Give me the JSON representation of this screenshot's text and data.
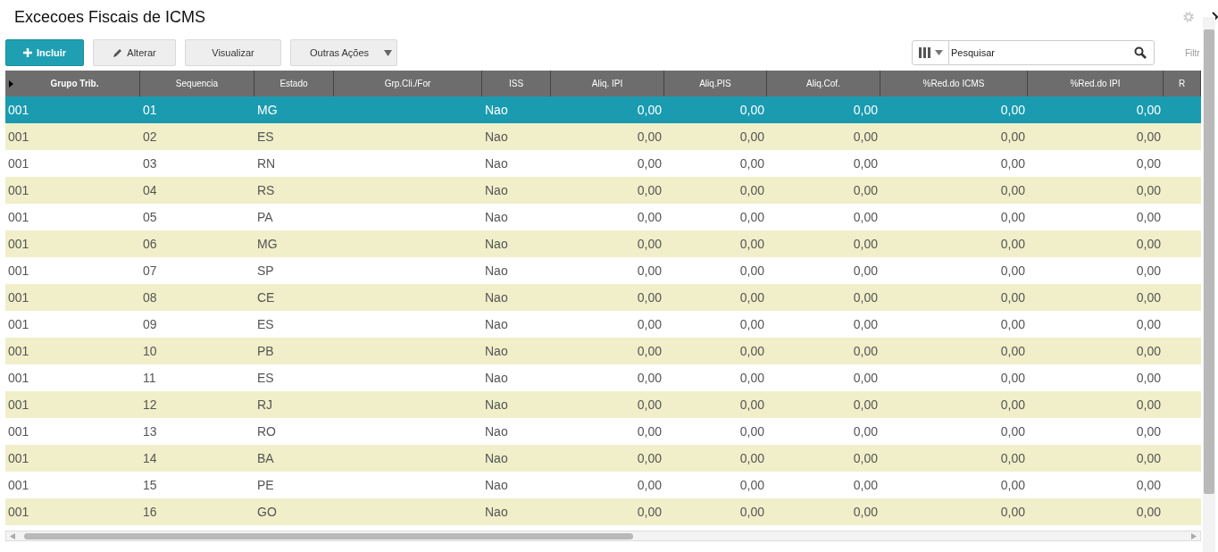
{
  "window": {
    "title": "Excecoes Fiscais de ICMS"
  },
  "toolbar": {
    "buttons": [
      {
        "label": "Incluir",
        "kind": "primary"
      },
      {
        "label": "Alterar",
        "kind": "edit"
      },
      {
        "label": "Visualizar",
        "kind": "plain"
      },
      {
        "label": "Outras Ações",
        "kind": "menu"
      }
    ],
    "search": {
      "placeholder": "Pesquisar"
    },
    "filter_label": "Filtr"
  },
  "table": {
    "columns": [
      "Grupo Trib.",
      "Sequencia",
      "Estado",
      "Grp.Cli./For",
      "ISS",
      "Aliq. IPI",
      "Aliq.PIS",
      "Aliq.Cof.",
      "%Red.do ICMS",
      "%Red.do IPI",
      "R"
    ],
    "rows": [
      {
        "selected": true,
        "cells": [
          "001",
          "01",
          "MG",
          "",
          "Nao",
          "0,00",
          "0,00",
          "0,00",
          "0,00",
          "0,00",
          ""
        ]
      },
      {
        "selected": false,
        "cells": [
          "001",
          "02",
          "ES",
          "",
          "Nao",
          "0,00",
          "0,00",
          "0,00",
          "0,00",
          "0,00",
          ""
        ]
      },
      {
        "selected": false,
        "cells": [
          "001",
          "03",
          "RN",
          "",
          "Nao",
          "0,00",
          "0,00",
          "0,00",
          "0,00",
          "0,00",
          ""
        ]
      },
      {
        "selected": false,
        "cells": [
          "001",
          "04",
          "RS",
          "",
          "Nao",
          "0,00",
          "0,00",
          "0,00",
          "0,00",
          "0,00",
          ""
        ]
      },
      {
        "selected": false,
        "cells": [
          "001",
          "05",
          "PA",
          "",
          "Nao",
          "0,00",
          "0,00",
          "0,00",
          "0,00",
          "0,00",
          ""
        ]
      },
      {
        "selected": false,
        "cells": [
          "001",
          "06",
          "MG",
          "",
          "Nao",
          "0,00",
          "0,00",
          "0,00",
          "0,00",
          "0,00",
          ""
        ]
      },
      {
        "selected": false,
        "cells": [
          "001",
          "07",
          "SP",
          "",
          "Nao",
          "0,00",
          "0,00",
          "0,00",
          "0,00",
          "0,00",
          ""
        ]
      },
      {
        "selected": false,
        "cells": [
          "001",
          "08",
          "CE",
          "",
          "Nao",
          "0,00",
          "0,00",
          "0,00",
          "0,00",
          "0,00",
          ""
        ]
      },
      {
        "selected": false,
        "cells": [
          "001",
          "09",
          "ES",
          "",
          "Nao",
          "0,00",
          "0,00",
          "0,00",
          "0,00",
          "0,00",
          ""
        ]
      },
      {
        "selected": false,
        "cells": [
          "001",
          "10",
          "PB",
          "",
          "Nao",
          "0,00",
          "0,00",
          "0,00",
          "0,00",
          "0,00",
          ""
        ]
      },
      {
        "selected": false,
        "cells": [
          "001",
          "11",
          "ES",
          "",
          "Nao",
          "0,00",
          "0,00",
          "0,00",
          "0,00",
          "0,00",
          ""
        ]
      },
      {
        "selected": false,
        "cells": [
          "001",
          "12",
          "RJ",
          "",
          "Nao",
          "0,00",
          "0,00",
          "0,00",
          "0,00",
          "0,00",
          ""
        ]
      },
      {
        "selected": false,
        "cells": [
          "001",
          "13",
          "RO",
          "",
          "Nao",
          "0,00",
          "0,00",
          "0,00",
          "0,00",
          "0,00",
          ""
        ]
      },
      {
        "selected": false,
        "cells": [
          "001",
          "14",
          "BA",
          "",
          "Nao",
          "0,00",
          "0,00",
          "0,00",
          "0,00",
          "0,00",
          ""
        ]
      },
      {
        "selected": false,
        "cells": [
          "001",
          "15",
          "PE",
          "",
          "Nao",
          "0,00",
          "0,00",
          "0,00",
          "0,00",
          "0,00",
          ""
        ]
      },
      {
        "selected": false,
        "cells": [
          "001",
          "16",
          "GO",
          "",
          "Nao",
          "0,00",
          "0,00",
          "0,00",
          "0,00",
          "0,00",
          ""
        ]
      }
    ]
  }
}
